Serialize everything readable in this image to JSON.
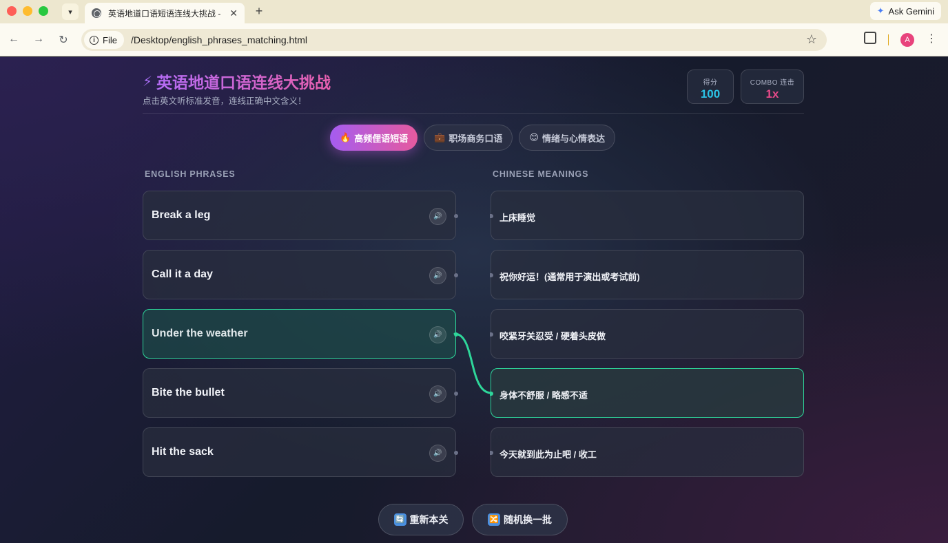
{
  "browser": {
    "tab_title": "英语地道口语短语连线大挑战 -",
    "new_tab": "+",
    "gemini_label": "Ask Gemini",
    "file_chip": "File",
    "url": "/Desktop/english_phrases_matching.html",
    "avatar_letter": "A"
  },
  "app": {
    "title": "英语地道口语连线大挑战",
    "subtitle": "点击英文听标准发音，连线正确中文含义！",
    "score": {
      "label": "得分",
      "value": "100"
    },
    "combo": {
      "label": "COMBO 连击",
      "value": "1x"
    }
  },
  "tabs": [
    {
      "emoji": "🔥",
      "label": "高频俚语短语",
      "active": true
    },
    {
      "emoji": "💼",
      "label": "职场商务口语",
      "active": false
    },
    {
      "emoji": "😊",
      "label": "情绪与心情表达",
      "active": false
    }
  ],
  "columns": {
    "english": "ENGLISH PHRASES",
    "chinese": "CHINESE MEANINGS"
  },
  "english_phrases": [
    {
      "text": "Break a leg",
      "matched": false
    },
    {
      "text": "Call it a day",
      "matched": false
    },
    {
      "text": "Under the weather",
      "matched": true
    },
    {
      "text": "Bite the bullet",
      "matched": false
    },
    {
      "text": "Hit the sack",
      "matched": false
    }
  ],
  "chinese_meanings": [
    {
      "text": "上床睡觉",
      "matched": false
    },
    {
      "text": "祝你好运！(通常用于演出或考试前)",
      "matched": false
    },
    {
      "text": "咬紧牙关忍受 / 硬着头皮做",
      "matched": false
    },
    {
      "text": "身体不舒服 / 略感不适",
      "matched": true
    },
    {
      "text": "今天就到此为止吧 / 收工",
      "matched": false
    }
  ],
  "actions": {
    "restart": {
      "icon": "🔄",
      "label": "重新本关"
    },
    "shuffle": {
      "icon": "🔀",
      "label": "随机换一批"
    }
  },
  "colors": {
    "accent_purple": "#a55cf0",
    "accent_pink": "#e65a9e",
    "match_green": "#2ed69a",
    "score_cyan": "#2bc3e6"
  }
}
